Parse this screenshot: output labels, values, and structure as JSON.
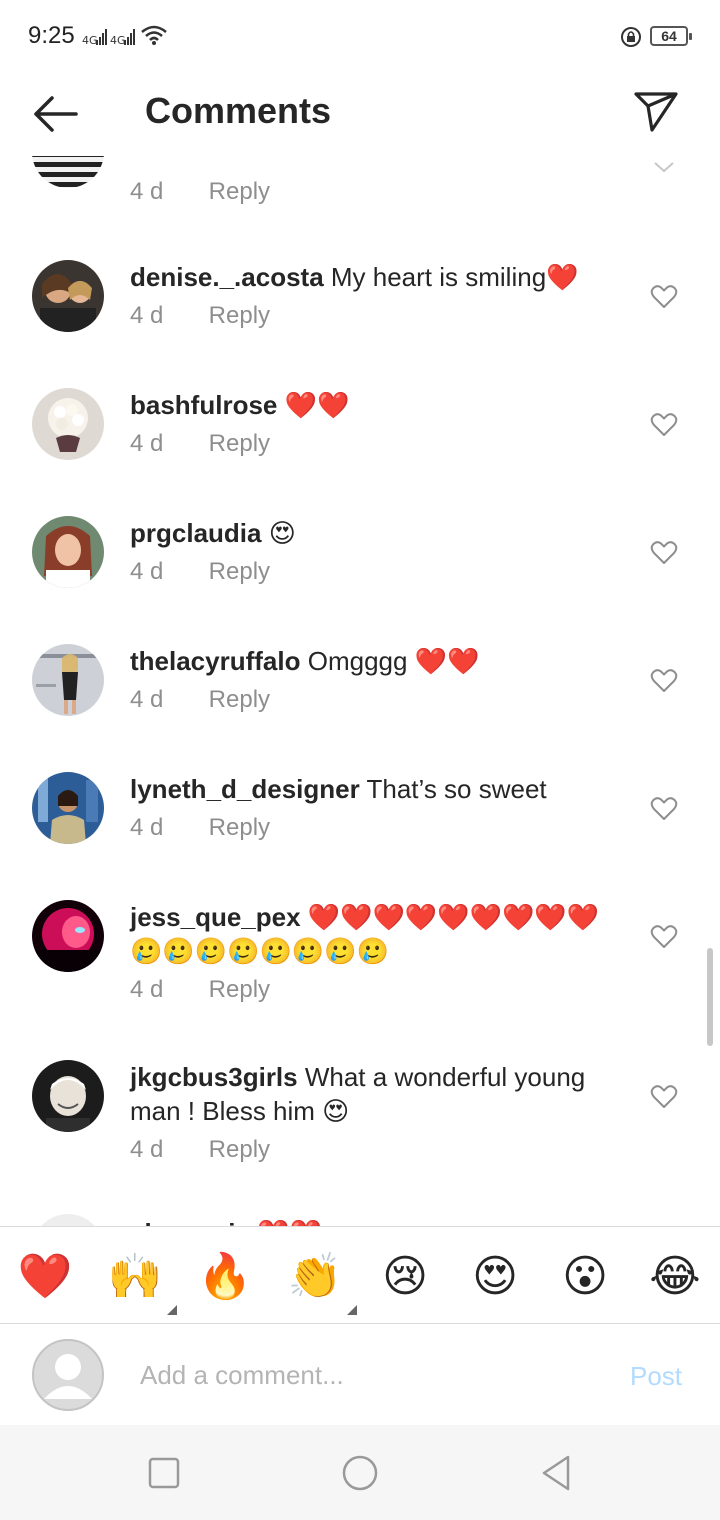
{
  "status_bar": {
    "time": "9:25",
    "battery": "64"
  },
  "header": {
    "title": "Comments"
  },
  "comments": [
    {
      "age": "4 d",
      "reply": "Reply"
    },
    {
      "username": "denise._.acosta",
      "text": " My heart is smiling❤️",
      "age": "4 d",
      "reply": "Reply"
    },
    {
      "username": "bashfulrose",
      "text": " ❤️❤️",
      "age": "4 d",
      "reply": "Reply"
    },
    {
      "username": "prgclaudia",
      "text": " 😍",
      "age": "4 d",
      "reply": "Reply"
    },
    {
      "username": "thelacyruffalo",
      "text": " Omgggg ❤️❤️",
      "age": "4 d",
      "reply": "Reply"
    },
    {
      "username": "lyneth_d_designer",
      "text": " That’s so sweet",
      "age": "4 d",
      "reply": "Reply"
    },
    {
      "username": "jess_que_pex",
      "text": " ❤️❤️❤️❤️❤️❤️❤️❤️❤️🥲🥲🥲🥲🥲🥲🥲🥲",
      "age": "4 d",
      "reply": "Reply"
    },
    {
      "username": "jkgcbus3girls",
      "text": " What a wonderful young man !  Bless him 😍",
      "age": "4 d",
      "reply": "Reply"
    },
    {
      "username": "alexmaria",
      "text": " ❤️❤️"
    }
  ],
  "emoji_bar": [
    "❤️",
    "🙌",
    "🔥",
    "👏",
    "😢",
    "😍",
    "😮",
    "😂"
  ],
  "comment_input": {
    "placeholder": "Add a comment...",
    "post_label": "Post"
  },
  "colors": {
    "heart_red": "#e0242b",
    "post_blue": "#b3dbff",
    "meta_gray": "#8e8e8e"
  }
}
